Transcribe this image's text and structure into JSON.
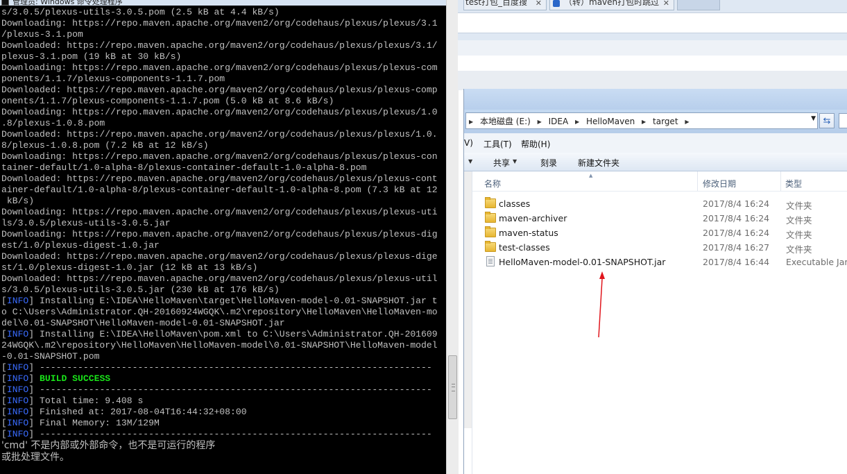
{
  "cmd": {
    "title": "管理员: Windows 命令处理程序",
    "lines": [
      {
        "text": "s/3.0.5/plexus-utils-3.0.5.pom (2.5 kB at 4.4 kB/s)"
      },
      {
        "text": "Downloading: https://repo.maven.apache.org/maven2/org/codehaus/plexus/plexus/3.1"
      },
      {
        "text": "/plexus-3.1.pom"
      },
      {
        "text": "Downloaded: https://repo.maven.apache.org/maven2/org/codehaus/plexus/plexus/3.1/"
      },
      {
        "text": "plexus-3.1.pom (19 kB at 30 kB/s)"
      },
      {
        "text": "Downloading: https://repo.maven.apache.org/maven2/org/codehaus/plexus/plexus-com"
      },
      {
        "text": "ponents/1.1.7/plexus-components-1.1.7.pom"
      },
      {
        "text": "Downloaded: https://repo.maven.apache.org/maven2/org/codehaus/plexus/plexus-comp"
      },
      {
        "text": "onents/1.1.7/plexus-components-1.1.7.pom (5.0 kB at 8.6 kB/s)"
      },
      {
        "text": "Downloading: https://repo.maven.apache.org/maven2/org/codehaus/plexus/plexus/1.0"
      },
      {
        "text": ".8/plexus-1.0.8.pom"
      },
      {
        "text": "Downloaded: https://repo.maven.apache.org/maven2/org/codehaus/plexus/plexus/1.0."
      },
      {
        "text": "8/plexus-1.0.8.pom (7.2 kB at 12 kB/s)"
      },
      {
        "text": "Downloading: https://repo.maven.apache.org/maven2/org/codehaus/plexus/plexus-con"
      },
      {
        "text": "tainer-default/1.0-alpha-8/plexus-container-default-1.0-alpha-8.pom"
      },
      {
        "text": "Downloaded: https://repo.maven.apache.org/maven2/org/codehaus/plexus/plexus-cont"
      },
      {
        "text": "ainer-default/1.0-alpha-8/plexus-container-default-1.0-alpha-8.pom (7.3 kB at 12"
      },
      {
        "text": " kB/s)"
      },
      {
        "text": "Downloading: https://repo.maven.apache.org/maven2/org/codehaus/plexus/plexus-uti"
      },
      {
        "text": "ls/3.0.5/plexus-utils-3.0.5.jar"
      },
      {
        "text": "Downloading: https://repo.maven.apache.org/maven2/org/codehaus/plexus/plexus-dig"
      },
      {
        "text": "est/1.0/plexus-digest-1.0.jar"
      },
      {
        "text": "Downloaded: https://repo.maven.apache.org/maven2/org/codehaus/plexus/plexus-dige"
      },
      {
        "text": "st/1.0/plexus-digest-1.0.jar (12 kB at 13 kB/s)"
      },
      {
        "text": "Downloaded: https://repo.maven.apache.org/maven2/org/codehaus/plexus/plexus-util"
      },
      {
        "text": "s/3.0.5/plexus-utils-3.0.5.jar (230 kB at 176 kB/s)"
      },
      {
        "info": true,
        "text": " Installing E:\\IDEA\\HelloMaven\\target\\HelloMaven-model-0.01-SNAPSHOT.jar t"
      },
      {
        "text": "o C:\\Users\\Administrator.QH-20160924WGQK\\.m2\\repository\\HelloMaven\\HelloMaven-mo"
      },
      {
        "text": "del\\0.01-SNAPSHOT\\HelloMaven-model-0.01-SNAPSHOT.jar"
      },
      {
        "info": true,
        "text": " Installing E:\\IDEA\\HelloMaven\\pom.xml to C:\\Users\\Administrator.QH-201609"
      },
      {
        "text": "24WGQK\\.m2\\repository\\HelloMaven\\HelloMaven-model\\0.01-SNAPSHOT\\HelloMaven-model"
      },
      {
        "text": "-0.01-SNAPSHOT.pom"
      },
      {
        "info": true,
        "text": " ------------------------------------------------------------------------"
      },
      {
        "info": true,
        "success": true,
        "text": " BUILD SUCCESS"
      },
      {
        "info": true,
        "text": " ------------------------------------------------------------------------"
      },
      {
        "info": true,
        "text": " Total time: 9.408 s"
      },
      {
        "info": true,
        "text": " Finished at: 2017-08-04T16:44:32+08:00"
      },
      {
        "info": true,
        "text": " Final Memory: 13M/129M"
      },
      {
        "info": true,
        "text": " ------------------------------------------------------------------------"
      },
      {
        "cn": true,
        "text": "'cmd' 不是内部或外部命令，也不是可运行的程序"
      },
      {
        "cn": true,
        "text": "或批处理文件。"
      }
    ],
    "info_tag": "INFO"
  },
  "browser": {
    "tabs": [
      {
        "label": "test打包_百度搜"
      },
      {
        "label": "（转）maven打包时跳过"
      }
    ],
    "close_glyph": "✕"
  },
  "explorer": {
    "breadcrumbs": [
      "本地磁盘 (E:)",
      "IDEA",
      "HelloMaven",
      "target"
    ],
    "menu": [
      "V)",
      "工具(T)",
      "帮助(H)"
    ],
    "toolbar": {
      "share": "共享",
      "burn": "刻录",
      "new_folder": "新建文件夹"
    },
    "columns": {
      "name": "名称",
      "date": "修改日期",
      "type": "类型"
    },
    "files": [
      {
        "name": "classes",
        "date": "2017/8/4 16:24",
        "type": "文件夹",
        "kind": "folder"
      },
      {
        "name": "maven-archiver",
        "date": "2017/8/4 16:24",
        "type": "文件夹",
        "kind": "folder"
      },
      {
        "name": "maven-status",
        "date": "2017/8/4 16:24",
        "type": "文件夹",
        "kind": "folder"
      },
      {
        "name": "test-classes",
        "date": "2017/8/4 16:27",
        "type": "文件夹",
        "kind": "folder"
      },
      {
        "name": "HelloMaven-model-0.01-SNAPSHOT.jar",
        "date": "2017/8/4 16:44",
        "type": "Executable Jar I",
        "kind": "jar"
      }
    ]
  },
  "annotation": {
    "color": "#e0151c"
  }
}
